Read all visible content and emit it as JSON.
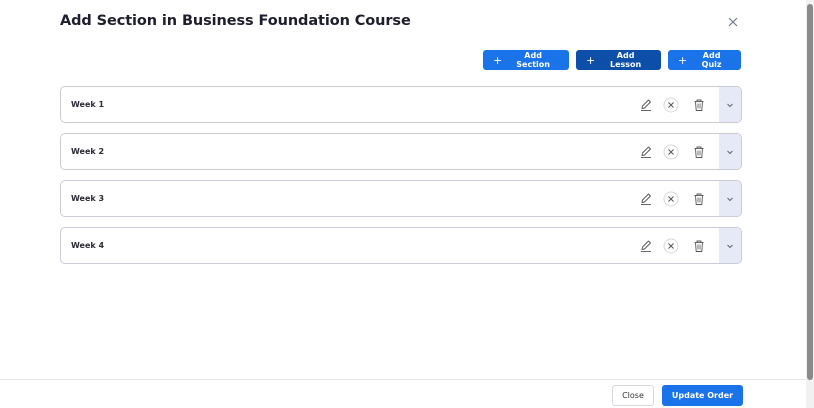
{
  "modal": {
    "title": "Add Section in Business Foundation Course"
  },
  "toolbar": {
    "add_section_label": "Add Section",
    "add_lesson_label": "Add Lesson",
    "add_quiz_label": "Add Quiz"
  },
  "sections": [
    {
      "label": "Week 1"
    },
    {
      "label": "Week 2"
    },
    {
      "label": "Week 3"
    },
    {
      "label": "Week 4"
    }
  ],
  "footer": {
    "close_label": "Close",
    "update_label": "Update Order"
  },
  "icons": {
    "close": "close-icon",
    "edit": "pencil-icon",
    "remove": "circle-x-icon",
    "delete": "trash-icon",
    "expand": "chevron-down-icon"
  },
  "colors": {
    "primary": "#1a73e8",
    "primary_dark": "#0d4fa8",
    "expand_bg": "#e6eaf6"
  }
}
